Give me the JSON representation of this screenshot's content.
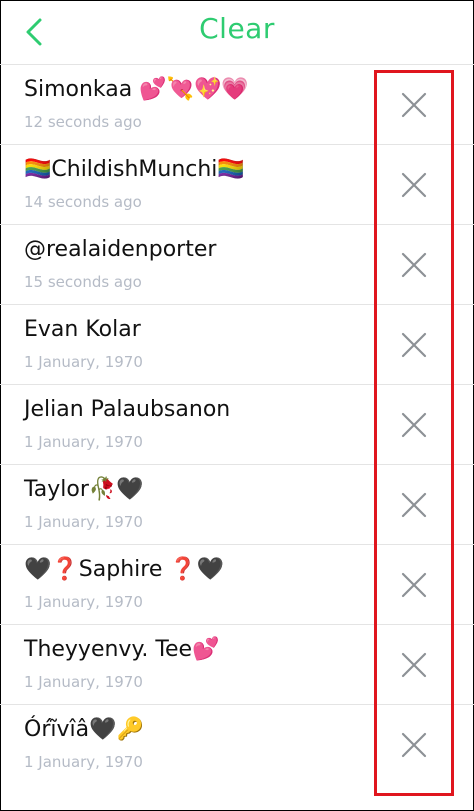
{
  "header": {
    "back_icon": "chevron-left-icon",
    "title": "Clear"
  },
  "colors": {
    "accent": "#2ecc71",
    "highlight": "#e0161e",
    "timestamp": "#b5bbc6"
  },
  "rows": [
    {
      "name": "Simonkaa 💕💘💖💗",
      "time": "12 seconds ago",
      "remove_icon": "close-icon"
    },
    {
      "name": "🏳️‍🌈ChildishMunchi🏳️‍🌈",
      "time": "14 seconds ago",
      "remove_icon": "close-icon"
    },
    {
      "name": "@realaidenporter",
      "time": "15 seconds ago",
      "remove_icon": "close-icon"
    },
    {
      "name": "Evan Kolar",
      "time": "1 January, 1970",
      "remove_icon": "close-icon"
    },
    {
      "name": "Jelian Palaubsanon",
      "time": "1 January, 1970",
      "remove_icon": "close-icon"
    },
    {
      "name": "Taylor🥀🖤",
      "time": "1 January, 1970",
      "remove_icon": "close-icon"
    },
    {
      "name": "🖤❓Saphire ❓🖤",
      "time": "1 January, 1970",
      "remove_icon": "close-icon"
    },
    {
      "name": "Theyyenvy. Tee💕",
      "time": "1 January, 1970",
      "remove_icon": "close-icon"
    },
    {
      "name": "Óŕĩvîâ🖤🔑",
      "time": "1 January, 1970",
      "remove_icon": "close-icon"
    }
  ]
}
